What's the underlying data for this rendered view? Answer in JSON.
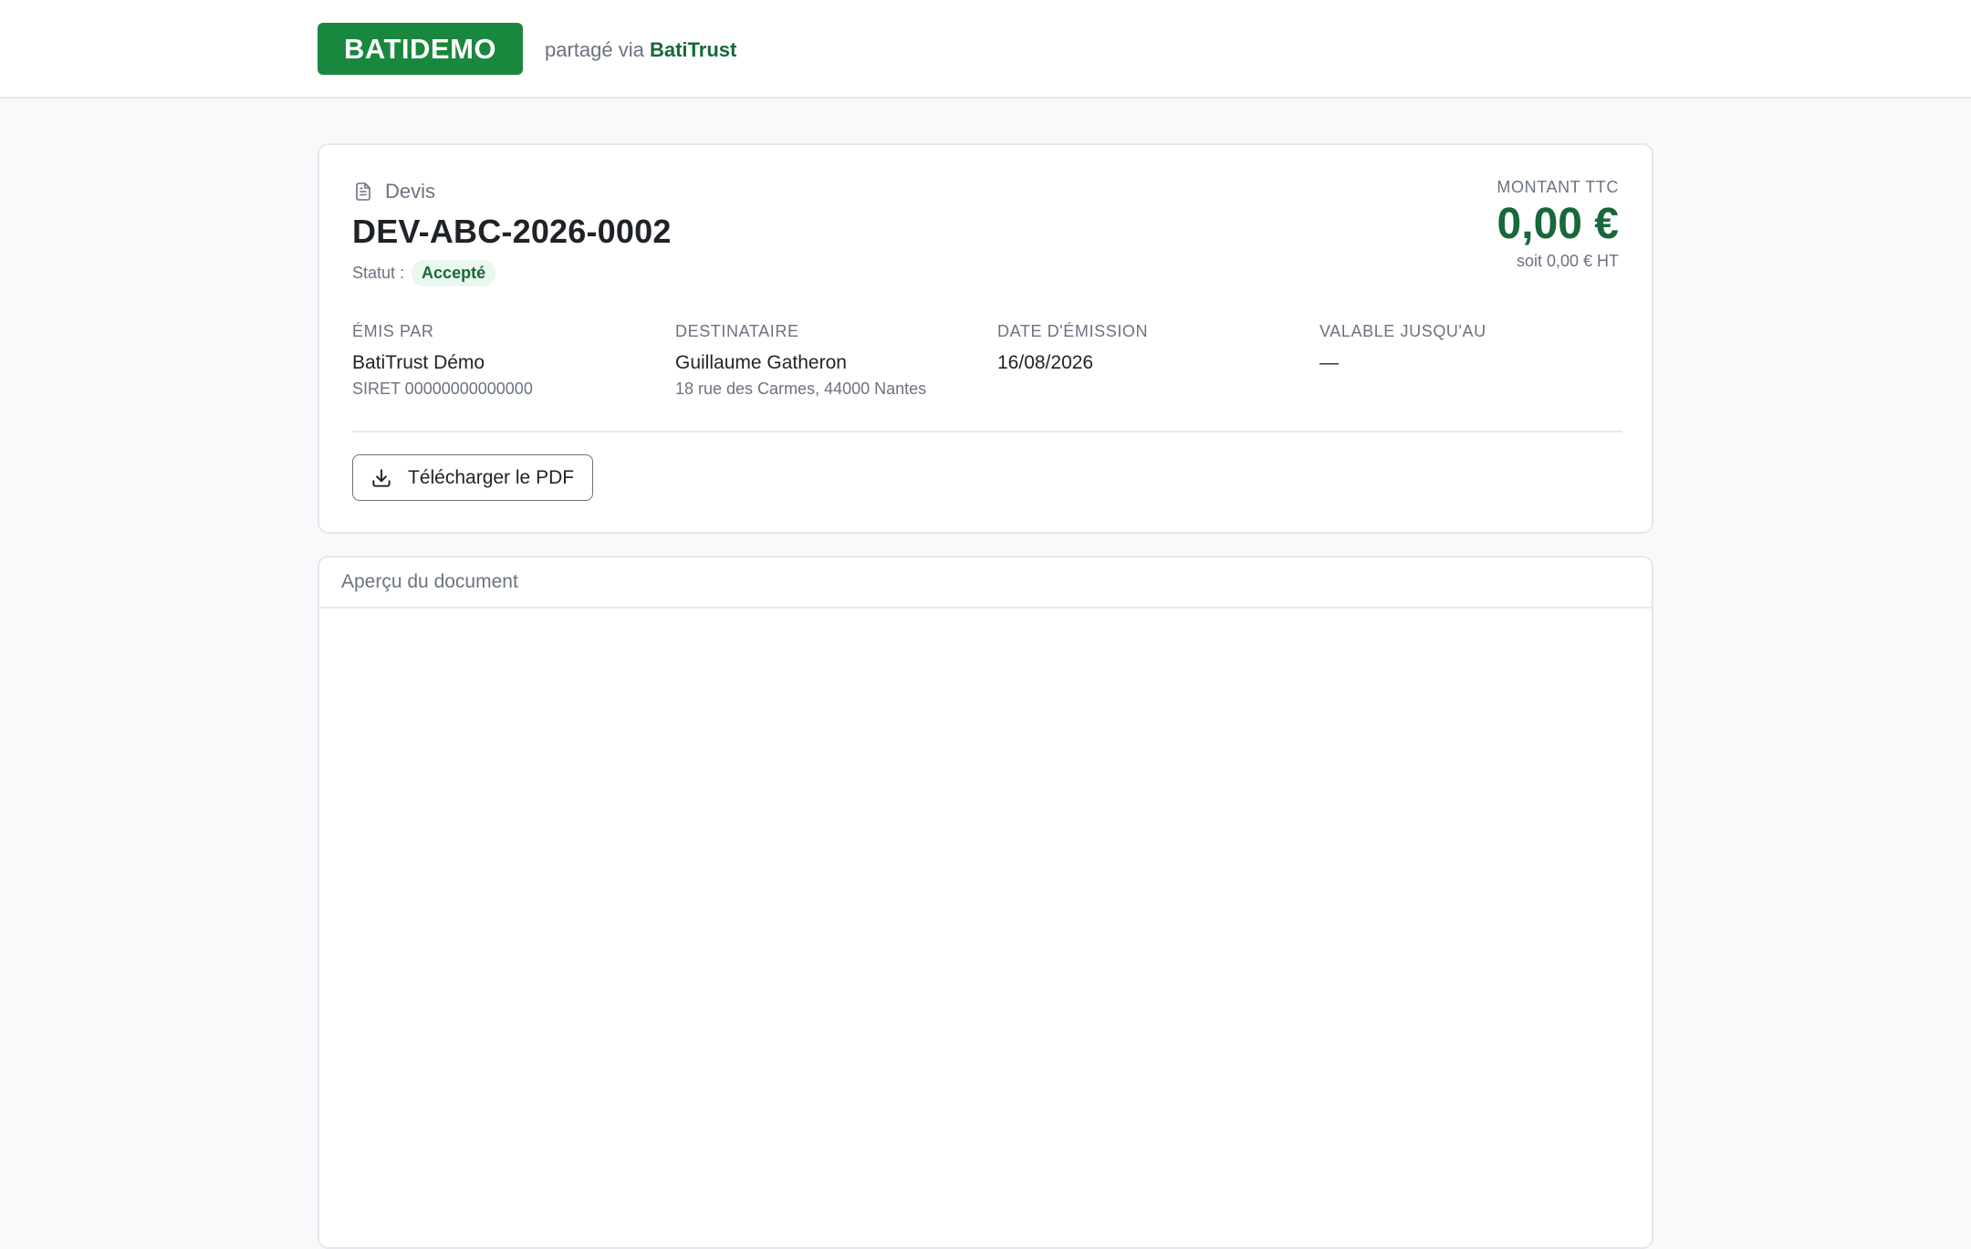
{
  "header": {
    "brand_name": "BATIDEMO",
    "shared_via_prefix": "partagé via",
    "shared_via_brand": "BatiTrust"
  },
  "document": {
    "type_label": "Devis",
    "type_icon": "document-icon",
    "number": "DEV-ABC-2026-0002",
    "status_label": "Statut :",
    "status_value": "Accepté"
  },
  "amount": {
    "label": "MONTANT TTC",
    "value": "0,00 €",
    "ht_text": "soit 0,00 € HT"
  },
  "info": {
    "issuer": {
      "label": "ÉMIS PAR",
      "name": "BatiTrust Démo",
      "detail": "SIRET 00000000000000"
    },
    "recipient": {
      "label": "DESTINATAIRE",
      "name": "Guillaume Gatheron",
      "detail": "18 rue des Carmes, 44000 Nantes"
    },
    "issue_date": {
      "label": "DATE D'ÉMISSION",
      "value": "16/08/2026"
    },
    "valid_until": {
      "label": "VALABLE JUSQU'AU",
      "value": "—"
    }
  },
  "actions": {
    "download_pdf_label": "Télécharger le PDF",
    "download_icon": "download-icon"
  },
  "preview": {
    "title": "Aperçu du document"
  },
  "colors": {
    "brand_green": "#1a873f",
    "amount_green": "#17683a",
    "badge_bg": "#eaf7ee"
  }
}
